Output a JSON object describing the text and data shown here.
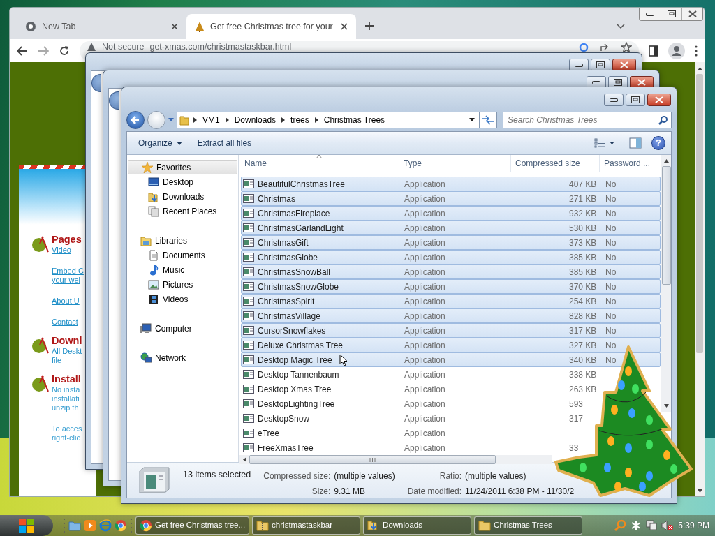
{
  "browser": {
    "tabs": [
      {
        "title": "New Tab",
        "selected": false
      },
      {
        "title": "Get free Christmas tree for your",
        "selected": true
      }
    ],
    "security_label": "Not secure",
    "url": "get-xmas.com/christmastaskbar.html"
  },
  "web_page": {
    "sections": [
      {
        "heading": "Pages",
        "items": [
          {
            "kind": "link",
            "lines": [
              "Video"
            ]
          },
          {
            "kind": "link",
            "lines": [
              "Embed C",
              "your wel"
            ]
          },
          {
            "kind": "link",
            "lines": [
              "About U"
            ]
          },
          {
            "kind": "link",
            "lines": [
              "Contact"
            ]
          }
        ]
      },
      {
        "heading": "Downl",
        "items": [
          {
            "kind": "link",
            "lines": [
              "All Deskt",
              "file"
            ]
          }
        ]
      },
      {
        "heading": "Install",
        "items": [
          {
            "kind": "text",
            "lines": [
              "No insta",
              "installati",
              "unzip th"
            ]
          },
          {
            "kind": "text",
            "lines": [
              "To acces",
              "right-clic"
            ]
          }
        ]
      }
    ]
  },
  "explorer": {
    "breadcrumb": [
      "VM1",
      "Downloads",
      "trees",
      "Christmas Trees"
    ],
    "search": {
      "placeholder": "Search Christmas Trees"
    },
    "toolbar": [
      {
        "label": "Organize",
        "dropdown": true
      },
      {
        "label": "Extract all files",
        "dropdown": false
      }
    ],
    "help_label": "?",
    "nav": [
      {
        "label": "Favorites",
        "kind": "favorites",
        "selected": true,
        "children": [
          {
            "label": "Desktop",
            "kind": "desktop"
          },
          {
            "label": "Downloads",
            "kind": "downloads"
          },
          {
            "label": "Recent Places",
            "kind": "recent"
          }
        ]
      },
      {
        "label": "Libraries",
        "kind": "libraries",
        "selected": false,
        "children": [
          {
            "label": "Documents",
            "kind": "documents"
          },
          {
            "label": "Music",
            "kind": "music"
          },
          {
            "label": "Pictures",
            "kind": "pictures"
          },
          {
            "label": "Videos",
            "kind": "videos"
          }
        ]
      },
      {
        "label": "Computer",
        "kind": "computer",
        "selected": false
      },
      {
        "label": "Network",
        "kind": "network",
        "selected": false
      }
    ],
    "columns": [
      "Name",
      "Type",
      "Compressed size",
      "Password ..."
    ],
    "rows": [
      {
        "name": "BeautifulChristmasTree",
        "type": "Application",
        "size": "407 KB",
        "password": "No",
        "selected": true
      },
      {
        "name": "Christmas",
        "type": "Application",
        "size": "271 KB",
        "password": "No",
        "selected": true
      },
      {
        "name": "ChristmasFireplace",
        "type": "Application",
        "size": "932 KB",
        "password": "No",
        "selected": true
      },
      {
        "name": "ChristmasGarlandLight",
        "type": "Application",
        "size": "530 KB",
        "password": "No",
        "selected": true
      },
      {
        "name": "ChristmasGift",
        "type": "Application",
        "size": "373 KB",
        "password": "No",
        "selected": true
      },
      {
        "name": "ChristmasGlobe",
        "type": "Application",
        "size": "385 KB",
        "password": "No",
        "selected": true
      },
      {
        "name": "ChristmasSnowBall",
        "type": "Application",
        "size": "385 KB",
        "password": "No",
        "selected": true
      },
      {
        "name": "ChristmasSnowGlobe",
        "type": "Application",
        "size": "370 KB",
        "password": "No",
        "selected": true
      },
      {
        "name": "ChristmasSpirit",
        "type": "Application",
        "size": "254 KB",
        "password": "No",
        "selected": true
      },
      {
        "name": "ChristmasVillage",
        "type": "Application",
        "size": "828 KB",
        "password": "No",
        "selected": true
      },
      {
        "name": "CursorSnowflakes",
        "type": "Application",
        "size": "317 KB",
        "password": "No",
        "selected": true
      },
      {
        "name": "Deluxe Christmas Tree",
        "type": "Application",
        "size": "327 KB",
        "password": "No",
        "selected": true
      },
      {
        "name": "Desktop Magic Tree",
        "type": "Application",
        "size": "340 KB",
        "password": "No",
        "selected": true
      },
      {
        "name": "Desktop Tannenbaum",
        "type": "Application",
        "size": "338 KB",
        "selected": false
      },
      {
        "name": "Desktop Xmas Tree",
        "type": "Application",
        "size": "263 KB",
        "selected": false
      },
      {
        "name": "DesktopLightingTree",
        "type": "Application",
        "size": "593",
        "selected": false
      },
      {
        "name": "DesktopSnow",
        "type": "Application",
        "size": "317",
        "selected": false
      },
      {
        "name": "eTree",
        "type": "Application",
        "selected": false
      },
      {
        "name": "FreeXmasTree",
        "type": "Application",
        "size": "33",
        "selected": false
      }
    ],
    "details": {
      "summary": "13 items selected",
      "fields": [
        {
          "label": "Compressed size:",
          "value": "(multiple values)"
        },
        {
          "label": "Size:",
          "value": "9.31 MB"
        },
        {
          "label": "Ratio:",
          "value": "(multiple values)"
        },
        {
          "label": "Date modified:",
          "value": "11/24/2011 6:38 PM - 11/30/2"
        }
      ]
    }
  },
  "taskbar": {
    "tasks": [
      {
        "label": "Get free Christmas tree...",
        "kind": "browser"
      },
      {
        "label": "christmastaskbar",
        "kind": "zip"
      },
      {
        "label": "Downloads",
        "kind": "downloads"
      },
      {
        "label": "Christmas Trees",
        "kind": "folder"
      }
    ],
    "clock": "5:39 PM"
  }
}
